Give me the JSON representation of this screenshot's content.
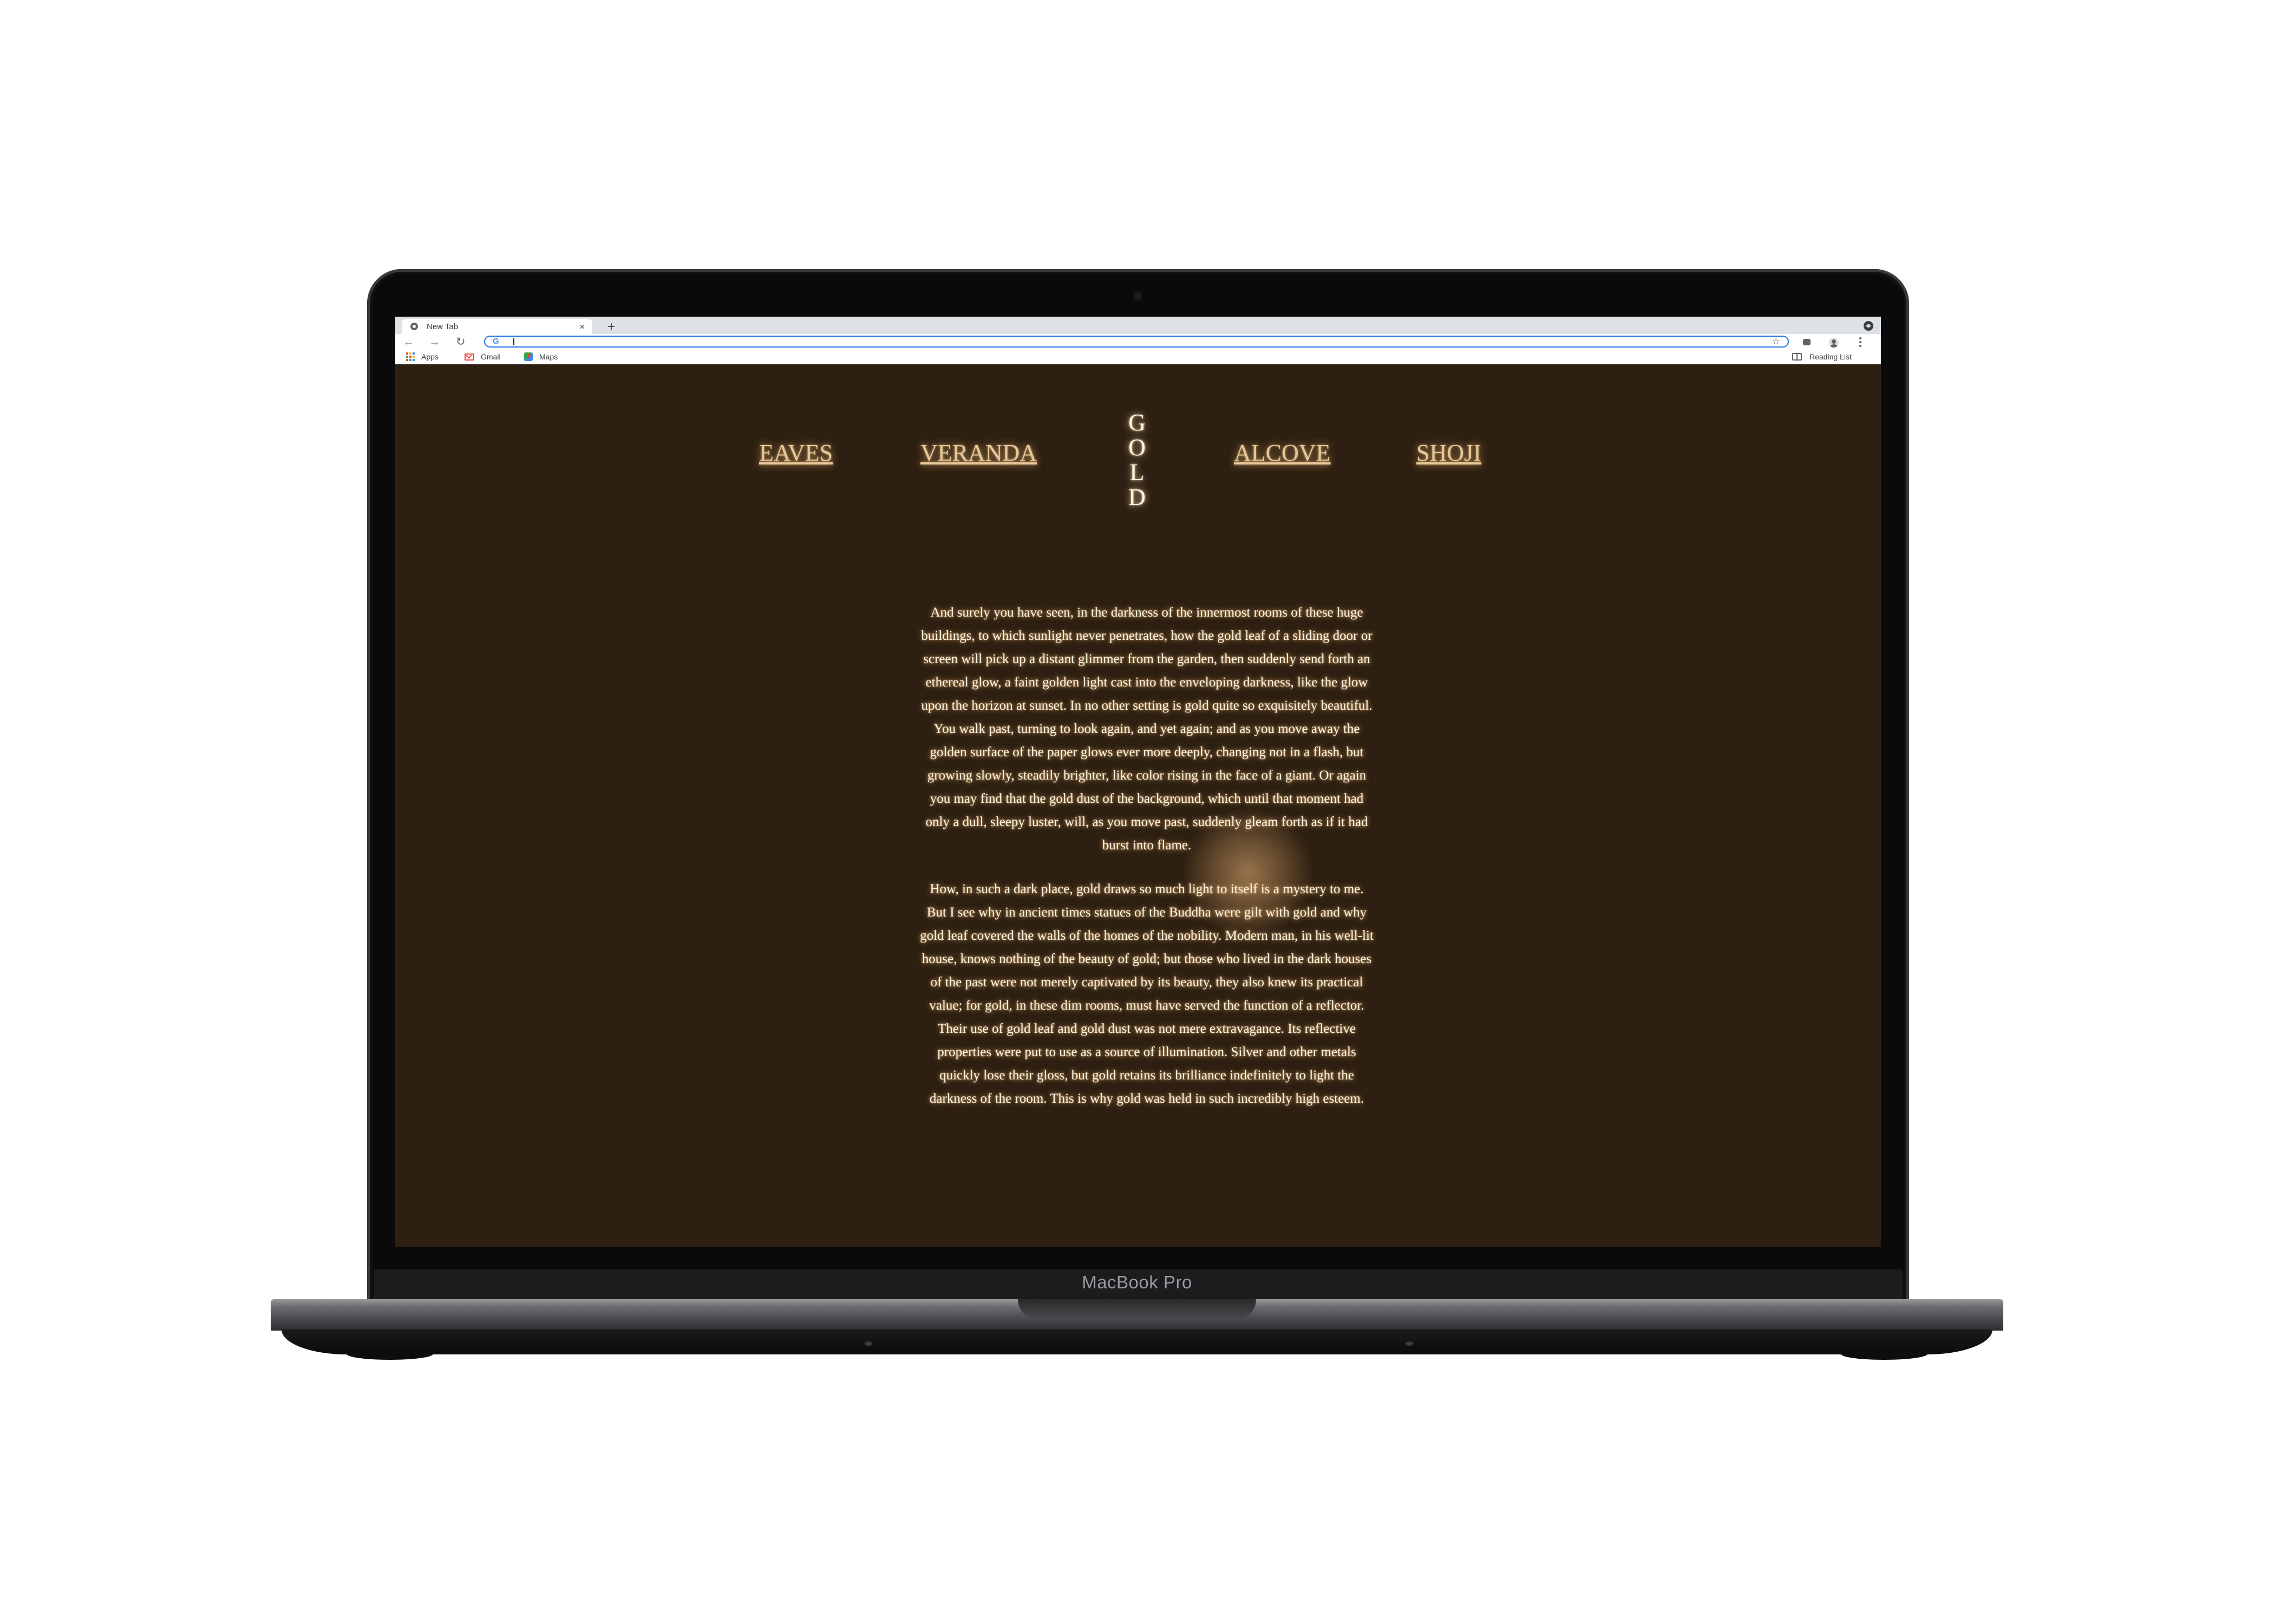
{
  "device": {
    "label": "MacBook Pro"
  },
  "browser": {
    "tab": {
      "title": "New Tab",
      "close_glyph": "×"
    },
    "new_tab_glyph": "+",
    "omnibox": {
      "g_logo": "G",
      "value": ""
    },
    "nav": {
      "back_glyph": "←",
      "forward_glyph": "→",
      "reload_glyph": "↻"
    },
    "star_glyph": "☆",
    "bookmarks": [
      {
        "label": "Apps",
        "icon": "apps-grid-icon"
      },
      {
        "label": "Gmail",
        "icon": "gmail-icon"
      },
      {
        "label": "Maps",
        "icon": "maps-icon"
      }
    ],
    "reading_list": "Reading List"
  },
  "site": {
    "colors": {
      "background": "#2d1f11",
      "link": "#e8c79a",
      "text": "#fff4e2",
      "glow": "#f5c482"
    },
    "nav": [
      {
        "label": "EAVES"
      },
      {
        "label": "VERANDA"
      },
      {
        "label": "ALCOVE"
      },
      {
        "label": "SHOJI"
      }
    ],
    "title_letters": [
      "G",
      "O",
      "L",
      "D"
    ],
    "paragraphs": [
      "And surely you have seen, in the darkness of the innermost rooms of these huge buildings, to which sunlight never penetrates, how the gold leaf of a sliding door or screen will pick up a distant glimmer from the garden, then suddenly send forth an ethereal glow, a faint golden light cast into the enveloping darkness, like the glow upon the horizon at sunset. In no other setting is gold quite so exquisitely beautiful. You walk past, turning to look again, and yet again; and as you move away the golden surface of the paper glows ever more deeply, changing not in a flash, but growing slowly, steadily brighter, like color rising in the face of a giant. Or again you may find that the gold dust of the background, which until that moment had only a dull, sleepy luster, will, as you move past, suddenly gleam forth as if it had burst into flame.",
      "How, in such a dark place, gold draws so much light to itself is a mystery to me. But I see why in ancient times statues of the Buddha were gilt with gold and why gold leaf covered the walls of the homes of the nobility. Modern man, in his well-lit house, knows nothing of the beauty of gold; but those who lived in the dark houses of the past were not merely captivated by its beauty, they also knew its practical value; for gold, in these dim rooms, must have served the function of a reflector. Their use of gold leaf and gold dust was not mere extravagance. Its reflective properties were put to use as a source of illumination. Silver and other metals quickly lose their gloss, but gold retains its brilliance indefinitely to light the darkness of the room. This is why gold was held in such incredibly high esteem."
    ]
  }
}
